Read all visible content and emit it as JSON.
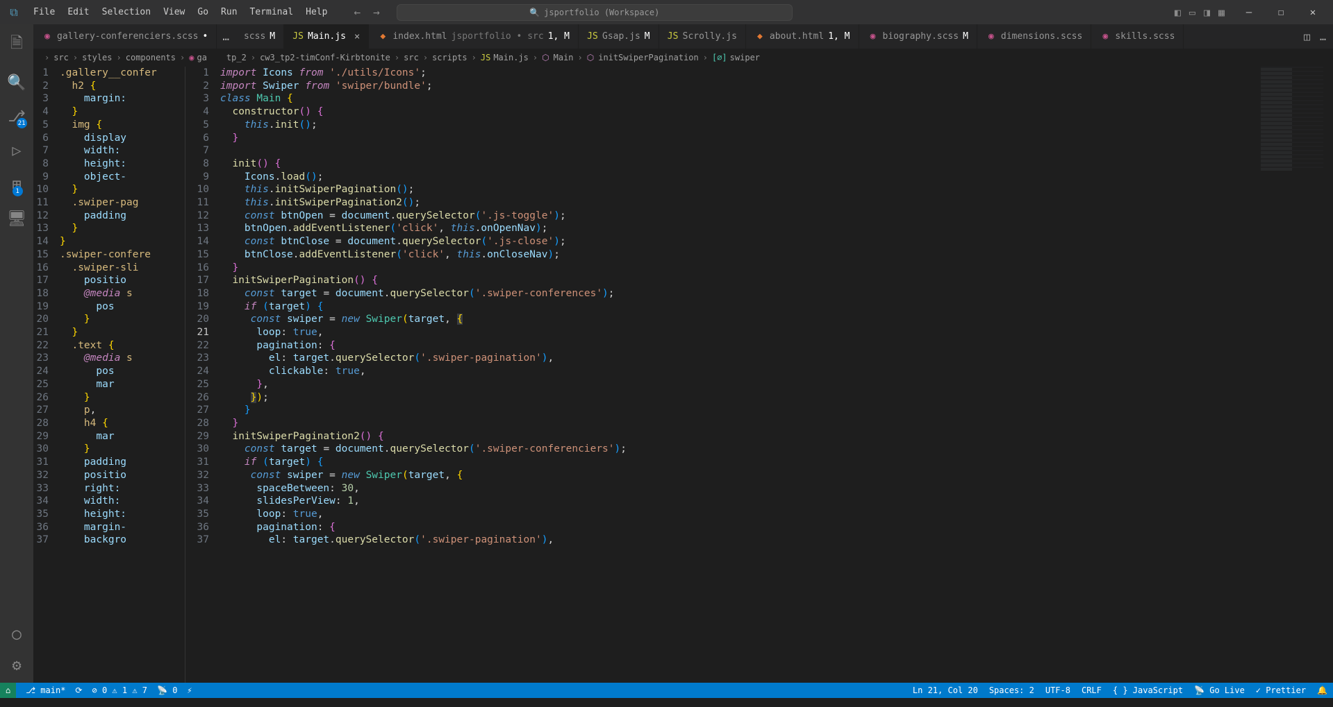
{
  "menu": {
    "file": "File",
    "edit": "Edit",
    "selection": "Selection",
    "view": "View",
    "go": "Go",
    "run": "Run",
    "terminal": "Terminal",
    "help": "Help"
  },
  "search": "jsportfolio (Workspace)",
  "activity_badges": {
    "scm": "21",
    "ext": "1"
  },
  "tabs": [
    {
      "icon": "◉",
      "iconClass": "icon-scss",
      "label": "gallery-conferenciers.scss",
      "modified": "•"
    },
    {
      "icon": "",
      "label": "…"
    },
    {
      "icon": "◉",
      "iconClass": "icon-scss",
      "label": "scss",
      "modified": "M"
    },
    {
      "icon": "JS",
      "iconClass": "icon-js",
      "label": "Main.js",
      "close": "×",
      "active": true
    },
    {
      "icon": "<>",
      "iconClass": "icon-html",
      "label": "index.html",
      "sub": "jsportfolio • src",
      "modified": "1, M"
    },
    {
      "icon": "JS",
      "iconClass": "icon-js",
      "label": "Gsap.js",
      "modified": "M"
    },
    {
      "icon": "JS",
      "iconClass": "icon-js",
      "label": "Scrolly.js"
    },
    {
      "icon": "<>",
      "iconClass": "icon-html",
      "label": "about.html",
      "modified": "1, M"
    },
    {
      "icon": "◉",
      "iconClass": "icon-scss",
      "label": "biography.scss",
      "modified": "M"
    },
    {
      "icon": "◉",
      "iconClass": "icon-scss",
      "label": "dimensions.scss"
    },
    {
      "icon": "◉",
      "iconClass": "icon-scss",
      "label": "skills.scss"
    }
  ],
  "breadcrumb": {
    "parts": [
      "tp_2",
      "cw3_tp2-timConf-Kirbtonite",
      "src",
      "scripts",
      "Main.js",
      "Main",
      "initSwiperPagination",
      "swiper"
    ]
  },
  "breadcrumb_left": [
    "src",
    "styles",
    "components",
    "ga"
  ],
  "status": {
    "branch": "main*",
    "sync": "⟳",
    "errors": "0",
    "warnings": "1",
    "problems_w": "7",
    "port": "0",
    "ln": "Ln 21, Col 20",
    "spaces": "Spaces: 2",
    "enc": "UTF-8",
    "eol": "CRLF",
    "lang": "JavaScript",
    "golive": "Go Live",
    "prettier": "Prettier"
  }
}
